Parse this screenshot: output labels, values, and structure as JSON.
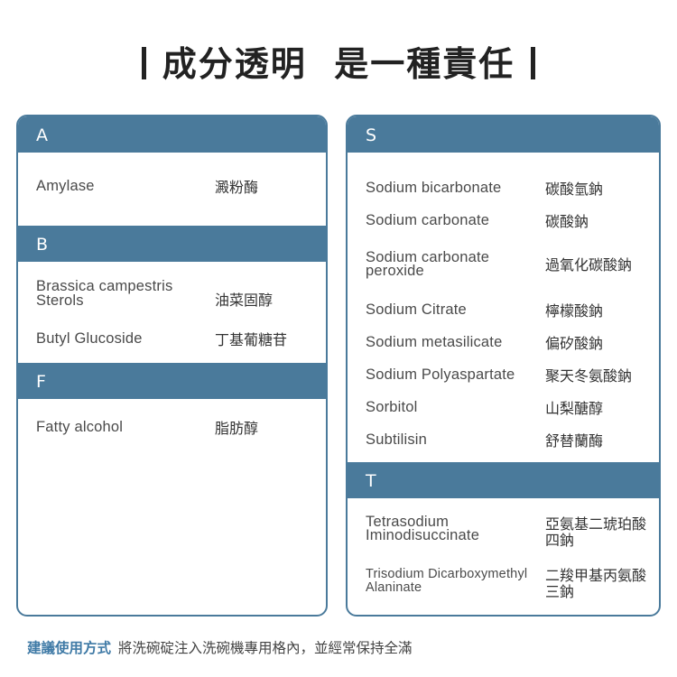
{
  "title": {
    "part1": "成分透明",
    "part2": "是一種責任"
  },
  "accent_color": "#4a7a9b",
  "left_card": {
    "sections": [
      {
        "letter": "A",
        "items": [
          {
            "en": "Amylase",
            "zh": "澱粉酶"
          }
        ]
      },
      {
        "letter": "B",
        "items": [
          {
            "en_line1": "Brassica campestris",
            "en_line2": "Sterols",
            "zh": "油菜固醇"
          },
          {
            "en": "Butyl Glucoside",
            "zh": "丁基葡糖苷"
          }
        ]
      },
      {
        "letter": "F",
        "items": [
          {
            "en": "Fatty alcohol",
            "zh": "脂肪醇"
          }
        ]
      }
    ]
  },
  "right_card": {
    "sections": [
      {
        "letter": "S",
        "items": [
          {
            "en": "Sodium bicarbonate",
            "zh": "碳酸氫鈉"
          },
          {
            "en": "Sodium carbonate",
            "zh": "碳酸鈉"
          },
          {
            "en_line1": "Sodium carbonate",
            "en_line2": "peroxide",
            "zh": "過氧化碳酸鈉"
          },
          {
            "en": "Sodium Citrate",
            "zh": "檸檬酸鈉"
          },
          {
            "en": "Sodium metasilicate",
            "zh": "偏矽酸鈉"
          },
          {
            "en": "Sodium Polyaspartate",
            "zh": "聚天冬氨酸鈉"
          },
          {
            "en": "Sorbitol",
            "zh": "山梨醣醇"
          },
          {
            "en": "Subtilisin",
            "zh": "舒替蘭酶"
          }
        ]
      },
      {
        "letter": "T",
        "items": [
          {
            "en_line1": "Tetrasodium",
            "en_line2": "Iminodisuccinate",
            "zh_line1": "亞氨基二琥珀酸",
            "zh_line2": "四鈉"
          },
          {
            "en_line1": "Trisodium Dicarboxymethyl",
            "en_line2": "Alaninate",
            "zh_line1": "二羧甲基丙氨酸",
            "zh_line2": "三鈉"
          }
        ]
      }
    ]
  },
  "usage": {
    "label": "建議使用方式",
    "text": "將洗碗碇注入洗碗機專用格內，並經常保持全滿"
  }
}
